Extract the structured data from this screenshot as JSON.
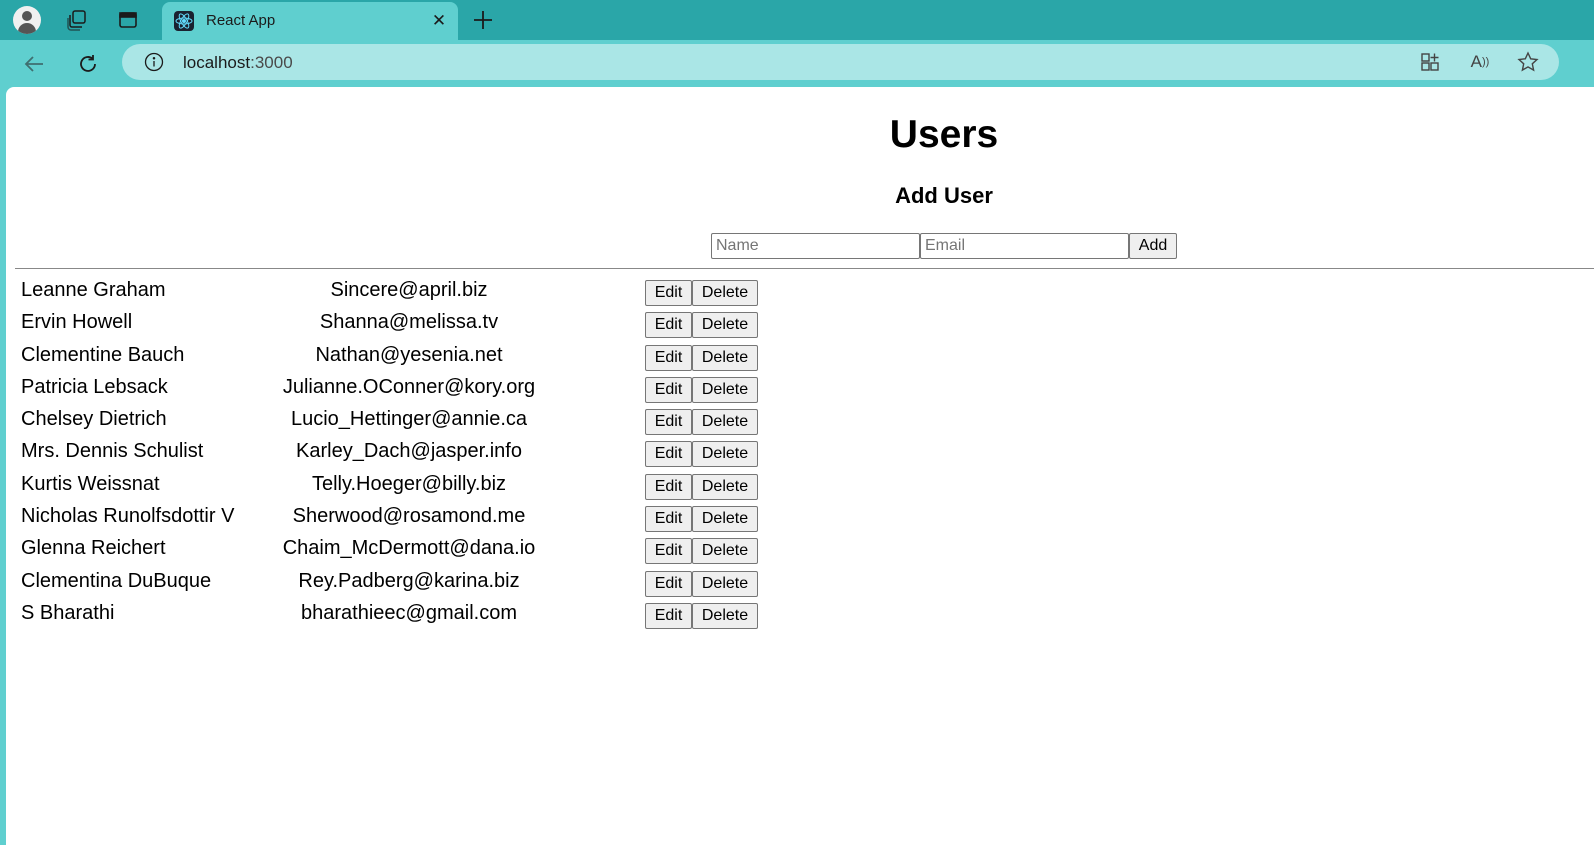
{
  "browser": {
    "tab_title": "React App",
    "url_host": "localhost",
    "url_port": ":3000"
  },
  "page": {
    "title": "Users",
    "subtitle": "Add User",
    "form": {
      "name_placeholder": "Name",
      "email_placeholder": "Email",
      "name_value": "",
      "email_value": "",
      "add_label": "Add"
    },
    "edit_label": "Edit",
    "delete_label": "Delete",
    "users": [
      {
        "name": "Leanne Graham",
        "email": "Sincere@april.biz"
      },
      {
        "name": "Ervin Howell",
        "email": "Shanna@melissa.tv"
      },
      {
        "name": "Clementine Bauch",
        "email": "Nathan@yesenia.net"
      },
      {
        "name": "Patricia Lebsack",
        "email": "Julianne.OConner@kory.org"
      },
      {
        "name": "Chelsey Dietrich",
        "email": "Lucio_Hettinger@annie.ca"
      },
      {
        "name": "Mrs. Dennis Schulist",
        "email": "Karley_Dach@jasper.info"
      },
      {
        "name": "Kurtis Weissnat",
        "email": "Telly.Hoeger@billy.biz"
      },
      {
        "name": "Nicholas Runolfsdottir V",
        "email": "Sherwood@rosamond.me"
      },
      {
        "name": "Glenna Reichert",
        "email": "Chaim_McDermott@dana.io"
      },
      {
        "name": "Clementina DuBuque",
        "email": "Rey.Padberg@karina.biz"
      },
      {
        "name": "S Bharathi",
        "email": "bharathieec@gmail.com"
      }
    ]
  },
  "icons": {
    "profile": "profile-icon",
    "workspaces": "workspaces-icon",
    "tab_actions": "tab-actions-icon",
    "favicon": "react-icon",
    "close": "close-icon",
    "new_tab": "plus-icon",
    "back": "back-arrow-icon",
    "reload": "reload-icon",
    "info": "info-icon",
    "apps": "apps-icon",
    "read_aloud": "read-aloud-icon",
    "favorites": "star-icon"
  }
}
